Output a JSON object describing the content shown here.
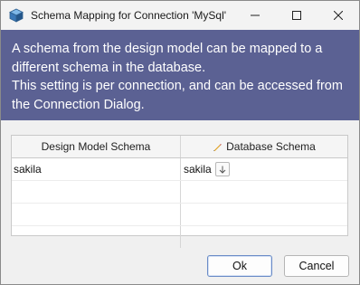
{
  "window": {
    "title": "Schema Mapping for Connection 'MySql'",
    "icon": "app-cube-icon"
  },
  "titlebar_buttons": {
    "minimize": "minimize-icon",
    "maximize": "maximize-icon",
    "close": "close-icon"
  },
  "banner": {
    "line1": "A schema from the design model can be mapped to a different schema in the database.",
    "line2": "This setting is per connection, and can be accessed from the Connection Dialog."
  },
  "grid": {
    "columns": [
      "Design Model Schema",
      "Database Schema"
    ],
    "editable_column_icon": "pencil-icon",
    "rows": [
      {
        "design": "sakila",
        "database": "sakila"
      },
      {
        "design": "",
        "database": ""
      },
      {
        "design": "",
        "database": ""
      },
      {
        "design": "",
        "database": ""
      }
    ]
  },
  "buttons": {
    "ok": "Ok",
    "cancel": "Cancel"
  },
  "colors": {
    "banner_bg": "#5b6193",
    "banner_text": "#ffffff",
    "pencil": "#e0a020",
    "default_button_border": "#6a8bc6"
  }
}
